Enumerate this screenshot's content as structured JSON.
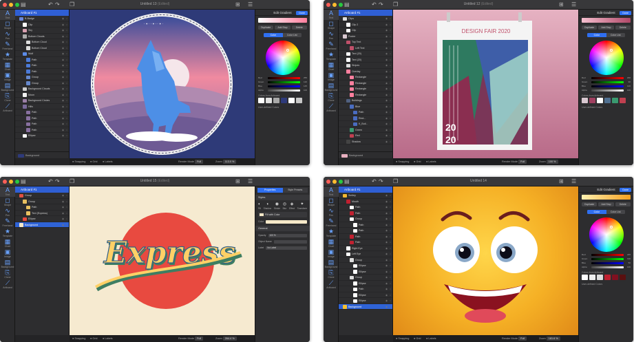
{
  "windows": [
    {
      "title": "Untitled 13",
      "edited": "(Edited)",
      "artboard": "Artboard #1",
      "layers": [
        {
          "depth": 0,
          "label": "B-Badge",
          "thumb": "#6a86d9",
          "sel": false
        },
        {
          "depth": 1,
          "label": "Clip",
          "thumb": "#ffffff",
          "sel": false
        },
        {
          "depth": 1,
          "label": "Sky",
          "thumb": "#d8a0b0",
          "sel": false
        },
        {
          "depth": 1,
          "label": "Bottom Clouds",
          "thumb": "#aaaaaa",
          "sel": false
        },
        {
          "depth": 2,
          "label": "Bottom Cloud",
          "thumb": "#dddddd",
          "sel": false
        },
        {
          "depth": 2,
          "label": "Bottom Cloud",
          "thumb": "#dddddd",
          "sel": false
        },
        {
          "depth": 1,
          "label": "Wolf",
          "thumb": "#5b8be8",
          "sel": false
        },
        {
          "depth": 2,
          "label": "Path",
          "thumb": "#4b7ad8",
          "sel": false
        },
        {
          "depth": 2,
          "label": "Path",
          "thumb": "#4b7ad8",
          "sel": false
        },
        {
          "depth": 2,
          "label": "Path",
          "thumb": "#4b7ad8",
          "sel": false
        },
        {
          "depth": 2,
          "label": "Group",
          "thumb": "#6688cc",
          "sel": false
        },
        {
          "depth": 2,
          "label": "Group",
          "thumb": "#6688cc",
          "sel": false
        },
        {
          "depth": 1,
          "label": "Background Clouds",
          "thumb": "#cccccc",
          "sel": false
        },
        {
          "depth": 1,
          "label": "Moon",
          "thumb": "#f2f2f2",
          "sel": false
        },
        {
          "depth": 1,
          "label": "Background Circles",
          "thumb": "#9a7fa6",
          "sel": false
        },
        {
          "depth": 1,
          "label": "Hills",
          "thumb": "#7a6a9a",
          "sel": false
        },
        {
          "depth": 2,
          "label": "Path",
          "thumb": "#8870a0",
          "sel": false
        },
        {
          "depth": 2,
          "label": "Path",
          "thumb": "#8870a0",
          "sel": false
        },
        {
          "depth": 2,
          "label": "Path",
          "thumb": "#8870a0",
          "sel": false
        },
        {
          "depth": 2,
          "label": "Path",
          "thumb": "#8870a0",
          "sel": false
        },
        {
          "depth": 1,
          "label": "Ellipse",
          "thumb": "#ffffff",
          "sel": false
        }
      ],
      "footer": {
        "label": "Background",
        "swatch": "#2e3a7a"
      },
      "inspector": {
        "title": "Edit Gradient",
        "done": "Done",
        "buttons": [
          "Duplicate",
          "Add Stop",
          "Delete"
        ],
        "tabs": [
          "Color",
          "Color List"
        ],
        "sliders": [
          {
            "label": "Red",
            "value": "255"
          },
          {
            "label": "Green",
            "value": "120"
          },
          {
            "label": "Blue",
            "value": "145"
          },
          {
            "label": "Alpha",
            "value": "100"
          }
        ],
        "swatch_label": "Colors from Artboard",
        "swatches": [
          "#ffffff",
          "#e0e0e0",
          "#a8a8a8",
          "#2e3a7a",
          "#ffffff",
          "#c8c8c8"
        ],
        "user_label": "User-defined Colors",
        "gradient": [
          "#ffffff",
          "#ff7f9e"
        ]
      },
      "status": {
        "snapping": "Snapping",
        "grid": "Grid",
        "labels": "Labels",
        "render_label": "Render Mode",
        "render_value": "Full",
        "zoom_label": "Zoom",
        "zoom_value": "113.0 %"
      }
    },
    {
      "title": "Untitled 12",
      "edited": "(Edited)",
      "artboard": "Artboard #1",
      "layers": [
        {
          "depth": 0,
          "label": "Clips",
          "thumb": "#dddddd",
          "sel": false
        },
        {
          "depth": 1,
          "label": "Clip 2",
          "thumb": "#ffffff",
          "sel": false
        },
        {
          "depth": 1,
          "label": "Clip",
          "thumb": "#ffffff",
          "sel": false
        },
        {
          "depth": 0,
          "label": "Poster",
          "thumb": "#d8c8d0",
          "sel": false
        },
        {
          "depth": 1,
          "label": "Top Text",
          "thumb": "#c0506a",
          "sel": false
        },
        {
          "depth": 2,
          "label": "Left Text",
          "thumb": "#c0506a",
          "sel": false
        },
        {
          "depth": 1,
          "label": "Text (20)",
          "thumb": "#ffffff",
          "sel": false
        },
        {
          "depth": 1,
          "label": "Text (20)",
          "thumb": "#ffffff",
          "sel": false
        },
        {
          "depth": 1,
          "label": "Stripes",
          "thumb": "#dddddd",
          "sel": false
        },
        {
          "depth": 1,
          "label": "Overlay",
          "thumb": "#ff7f9e",
          "sel": false
        },
        {
          "depth": 2,
          "label": "Rectangle",
          "thumb": "#ff7f9e",
          "sel": false
        },
        {
          "depth": 2,
          "label": "Rectangle",
          "thumb": "#ff7f9e",
          "sel": false
        },
        {
          "depth": 2,
          "label": "Rectangle",
          "thumb": "#ff7f9e",
          "sel": false
        },
        {
          "depth": 2,
          "label": "Rectangle",
          "thumb": "#ff7f9e",
          "sel": false
        },
        {
          "depth": 1,
          "label": "Buildings",
          "thumb": "#506080",
          "sel": false
        },
        {
          "depth": 2,
          "label": "Blue",
          "thumb": "#4a6cc0",
          "sel": false
        },
        {
          "depth": 3,
          "label": "Path",
          "thumb": "#4a6cc0",
          "sel": false
        },
        {
          "depth": 3,
          "label": "Rect...",
          "thumb": "#4a6cc0",
          "sel": false
        },
        {
          "depth": 3,
          "label": "K_Buil...",
          "thumb": "#4a6cc0",
          "sel": false
        },
        {
          "depth": 2,
          "label": "Green",
          "thumb": "#3a9a70",
          "sel": false
        },
        {
          "depth": 2,
          "label": "Red",
          "thumb": "#c04050",
          "sel": false
        },
        {
          "depth": 1,
          "label": "Shadow",
          "thumb": "#444444",
          "sel": false
        }
      ],
      "footer": {
        "label": "Background",
        "swatch": "#e8b0c0"
      },
      "inspector": {
        "title": "Edit Gradient",
        "done": "Done",
        "buttons": [
          "Duplicate",
          "Add Stop",
          "Delete"
        ],
        "tabs": [
          "Color",
          "Color List"
        ],
        "sliders": [
          {
            "label": "Red",
            "value": "200"
          },
          {
            "label": "Green",
            "value": "90"
          },
          {
            "label": "Blue",
            "value": "120"
          },
          {
            "label": "Alpha",
            "value": "100"
          }
        ],
        "swatch_label": "Colors from Artboard",
        "swatches": [
          "#d8c8d0",
          "#a04060",
          "#ffffff",
          "#507090",
          "#3a9a70",
          "#c04050"
        ],
        "user_label": "User-defined Colors",
        "gradient": [
          "#f6c0d0",
          "#b04868"
        ]
      },
      "status": {
        "snapping": "Snapping",
        "grid": "Grid",
        "labels": "Labels",
        "render_label": "Render Mode",
        "render_value": "Full",
        "zoom_label": "Zoom",
        "zoom_value": "100 %"
      }
    },
    {
      "title": "Untitled 15",
      "edited": "(Edited)",
      "artboard": "Artboard #1",
      "layers": [
        {
          "depth": 0,
          "label": "Group",
          "thumb": "#e05040",
          "sel": false
        },
        {
          "depth": 1,
          "label": "Group",
          "thumb": "#e8c060",
          "sel": false
        },
        {
          "depth": 2,
          "label": "Path",
          "thumb": "#e8c060",
          "sel": false
        },
        {
          "depth": 2,
          "label": "Text (Express)",
          "thumb": "#e8c060",
          "sel": false
        },
        {
          "depth": 1,
          "label": "Ellipse",
          "thumb": "#e84a40",
          "sel": false
        },
        {
          "depth": 0,
          "label": "Background",
          "thumb": "#f5e8c8",
          "sel": true
        }
      ],
      "footer": {
        "label": "",
        "swatch": ""
      },
      "inspector": {
        "tabs": [
          "Properties",
          "Style Presets"
        ],
        "styles_title": "Styles",
        "style_icons": [
          {
            "glyph": "◐",
            "label": "Fill"
          },
          {
            "glyph": "◑",
            "label": "Shadow"
          },
          {
            "glyph": "◉",
            "label": "Stroke"
          },
          {
            "glyph": "◎",
            "label": "Blur"
          },
          {
            "glyph": "◈",
            "label": "Effect"
          },
          {
            "glyph": "✦",
            "label": "Transform"
          }
        ],
        "fill_label": "Fill with Color",
        "color_label": "Color",
        "general_title": "General",
        "props": [
          {
            "label": "Opacity",
            "value": "100 %"
          },
          {
            "label": "Object Name",
            "value": ""
          },
          {
            "label": "Label",
            "value": "No Label"
          }
        ]
      },
      "status": {
        "snapping": "Snapping",
        "grid": "Grid",
        "labels": "Labels",
        "render_label": "Render Mode",
        "render_value": "Full",
        "zoom_label": "Zoom",
        "zoom_value": "264.4 %"
      }
    },
    {
      "title": "Untitled 14",
      "edited": "",
      "artboard": "Artboard #1",
      "layers": [
        {
          "depth": 0,
          "label": "Smiley",
          "thumb": "#f5b830",
          "sel": false
        },
        {
          "depth": 1,
          "label": "Mouth",
          "thumb": "#c02030",
          "sel": false
        },
        {
          "depth": 2,
          "label": "Path",
          "thumb": "#ffffff",
          "sel": false
        },
        {
          "depth": 2,
          "label": "Path",
          "thumb": "#c02030",
          "sel": false
        },
        {
          "depth": 2,
          "label": "Group",
          "thumb": "#ffffff",
          "sel": false
        },
        {
          "depth": 3,
          "label": "Path",
          "thumb": "#ffffff",
          "sel": false
        },
        {
          "depth": 3,
          "label": "Path",
          "thumb": "#ffffff",
          "sel": false
        },
        {
          "depth": 2,
          "label": "Path",
          "thumb": "#c02030",
          "sel": false
        },
        {
          "depth": 2,
          "label": "Path",
          "thumb": "#c02030",
          "sel": false
        },
        {
          "depth": 1,
          "label": "Right Eye",
          "thumb": "#ffffff",
          "sel": false
        },
        {
          "depth": 1,
          "label": "Left Eye",
          "thumb": "#ffffff",
          "sel": false
        },
        {
          "depth": 2,
          "label": "Group",
          "thumb": "#dddddd",
          "sel": false
        },
        {
          "depth": 3,
          "label": "Ellipse",
          "thumb": "#ffffff",
          "sel": false
        },
        {
          "depth": 3,
          "label": "Ellipse",
          "thumb": "#ffffff",
          "sel": false
        },
        {
          "depth": 2,
          "label": "Group",
          "thumb": "#dddddd",
          "sel": false
        },
        {
          "depth": 3,
          "label": "Ellipse",
          "thumb": "#ffffff",
          "sel": false
        },
        {
          "depth": 3,
          "label": "Path",
          "thumb": "#ffffff",
          "sel": false
        },
        {
          "depth": 3,
          "label": "Ellipse",
          "thumb": "#ffffff",
          "sel": false
        },
        {
          "depth": 3,
          "label": "Ellipse",
          "thumb": "#ffffff",
          "sel": false
        },
        {
          "depth": 0,
          "label": "Background",
          "thumb": "#f5c030",
          "sel": true
        }
      ],
      "footer": {
        "label": "",
        "swatch": ""
      },
      "inspector": {
        "title": "Edit Gradient",
        "done": "Done",
        "buttons": [
          "Duplicate",
          "Add Stop",
          "Delete"
        ],
        "tabs": [
          "Color",
          "Color List"
        ],
        "sliders": [
          {
            "label": "Red",
            "value": "245"
          },
          {
            "label": "Green",
            "value": "190"
          },
          {
            "label": "Blue",
            "value": "50"
          },
          {
            "label": "Alpha",
            "value": "100"
          }
        ],
        "swatch_label": "Colors from Artboard",
        "swatches": [
          "#ffffff",
          "#eeeeee",
          "#dddddd",
          "#c02030",
          "#801020",
          "#5a1010"
        ],
        "user_label": "User-defined Colors",
        "gradient": [
          "#fff1b0",
          "#f5a020"
        ]
      },
      "status": {
        "snapping": "Snapping",
        "grid": "Grid",
        "labels": "Labels",
        "render_label": "Render Mode",
        "render_value": "Full",
        "zoom_label": "Zoom",
        "zoom_value": "181.6 %"
      }
    }
  ],
  "tools": [
    {
      "glyph": "A",
      "label": "Text"
    },
    {
      "glyph": "◻",
      "label": "Shape"
    },
    {
      "glyph": "∿",
      "label": "Pen"
    },
    {
      "glyph": "✎",
      "label": "Freehand"
    },
    {
      "glyph": "★",
      "label": "Template"
    },
    {
      "glyph": "▦",
      "label": "Chart"
    },
    {
      "glyph": "▣",
      "label": "Image"
    },
    {
      "glyph": "▤",
      "label": "Background"
    },
    {
      "glyph": "⎘",
      "label": "Clone"
    },
    {
      "glyph": "⟋",
      "label": "Artboard"
    }
  ],
  "canvas": {
    "poster_title": "DESIGN FAIR 2020",
    "poster_year_a": "20",
    "poster_year_b": "20",
    "express_text": "Express"
  }
}
